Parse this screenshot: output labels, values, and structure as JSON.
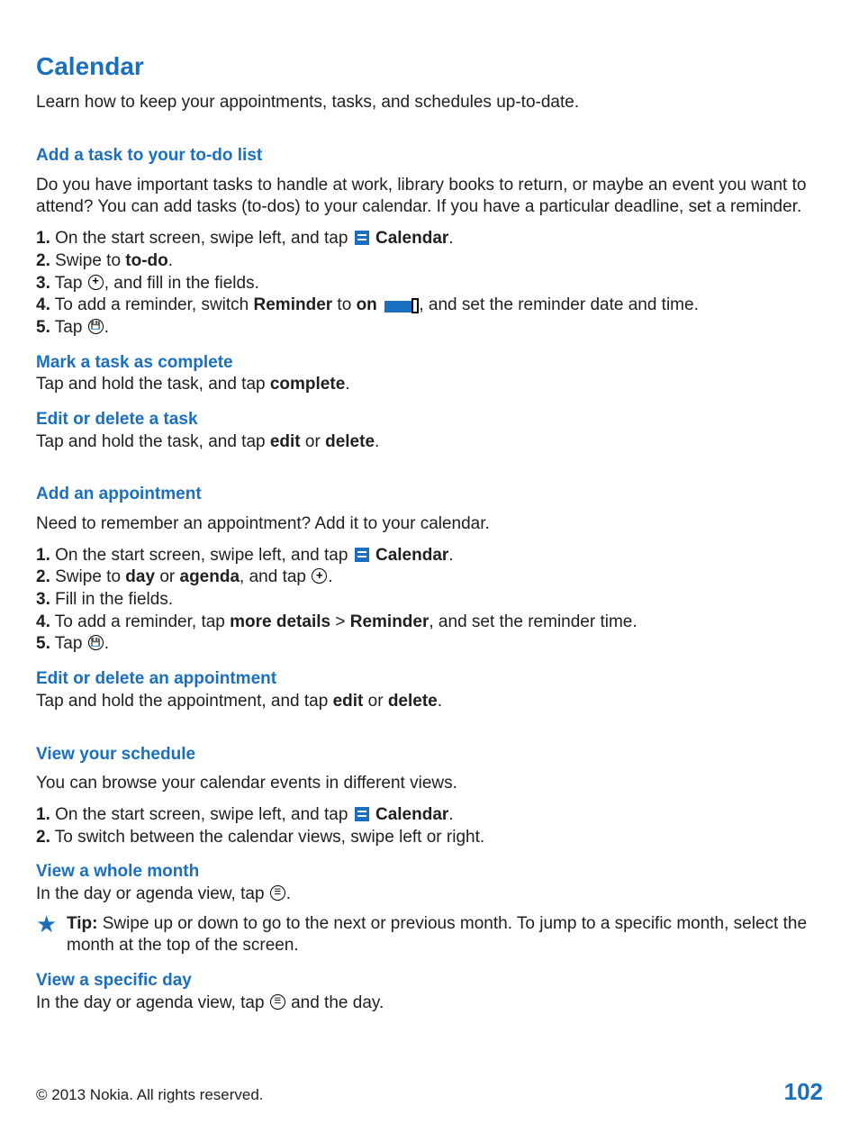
{
  "title": "Calendar",
  "intro": "Learn how to keep your appointments, tasks, and schedules up-to-date.",
  "s1": {
    "heading": "Add a task to your to-do list",
    "body": "Do you have important tasks to handle at work, library books to return, or maybe an event you want to attend? You can add tasks (to-dos) to your calendar. If you have a particular deadline, set a reminder.",
    "n1": "1.",
    "n2": "2.",
    "n3": "3.",
    "n4": "4.",
    "n5": "5.",
    "t1a": " On the start screen, swipe left, and tap ",
    "t1b": " Calendar",
    "t1c": ".",
    "t2a": " Swipe to ",
    "t2b": "to-do",
    "t2c": ".",
    "t3a": " Tap ",
    "t3b": ", and fill in the fields.",
    "t4a": " To add a reminder, switch ",
    "t4b": "Reminder",
    "t4c": " to ",
    "t4d": "on",
    "t4e": " , and set the reminder date and time.",
    "t5a": " Tap ",
    "t5b": ".",
    "sub1h": "Mark a task as complete",
    "sub1a": "Tap and hold the task, and tap ",
    "sub1b": "complete",
    "sub1c": ".",
    "sub2h": "Edit or delete a task",
    "sub2a": "Tap and hold the task, and tap ",
    "sub2b": "edit",
    "sub2c": " or ",
    "sub2d": "delete",
    "sub2e": "."
  },
  "s2": {
    "heading": "Add an appointment",
    "body": "Need to remember an appointment? Add it to your calendar.",
    "n1": "1.",
    "n2": "2.",
    "n3": "3.",
    "n4": "4.",
    "n5": "5.",
    "t1a": " On the start screen, swipe left, and tap ",
    "t1b": " Calendar",
    "t1c": ".",
    "t2a": " Swipe to ",
    "t2b": "day",
    "t2c": " or ",
    "t2d": "agenda",
    "t2e": ", and tap ",
    "t2f": ".",
    "t3": " Fill in the fields.",
    "t4a": " To add a reminder, tap ",
    "t4b": "more details",
    "t4c": " > ",
    "t4d": "Reminder",
    "t4e": ", and set the reminder time.",
    "t5a": " Tap ",
    "t5b": ".",
    "sub1h": "Edit or delete an appointment",
    "sub1a": "Tap and hold the appointment, and tap ",
    "sub1b": "edit",
    "sub1c": " or ",
    "sub1d": "delete",
    "sub1e": "."
  },
  "s3": {
    "heading": "View your schedule",
    "body": "You can browse your calendar events in different views.",
    "n1": "1.",
    "n2": "2.",
    "t1a": " On the start screen, swipe left, and tap ",
    "t1b": " Calendar",
    "t1c": ".",
    "t2": " To switch between the calendar views, swipe left or right.",
    "sub1h": "View a whole month",
    "sub1a": "In the day or agenda view, tap ",
    "sub1b": ".",
    "tiplabel": "Tip:",
    "tipbody": " Swipe up or down to go to the next or previous month. To jump to a specific month, select the month at the top of the screen.",
    "sub2h": "View a specific day",
    "sub2a": "In the day or agenda view, tap ",
    "sub2b": " and the day."
  },
  "footer": {
    "copyright": "© 2013 Nokia. All rights reserved.",
    "page": "102"
  }
}
